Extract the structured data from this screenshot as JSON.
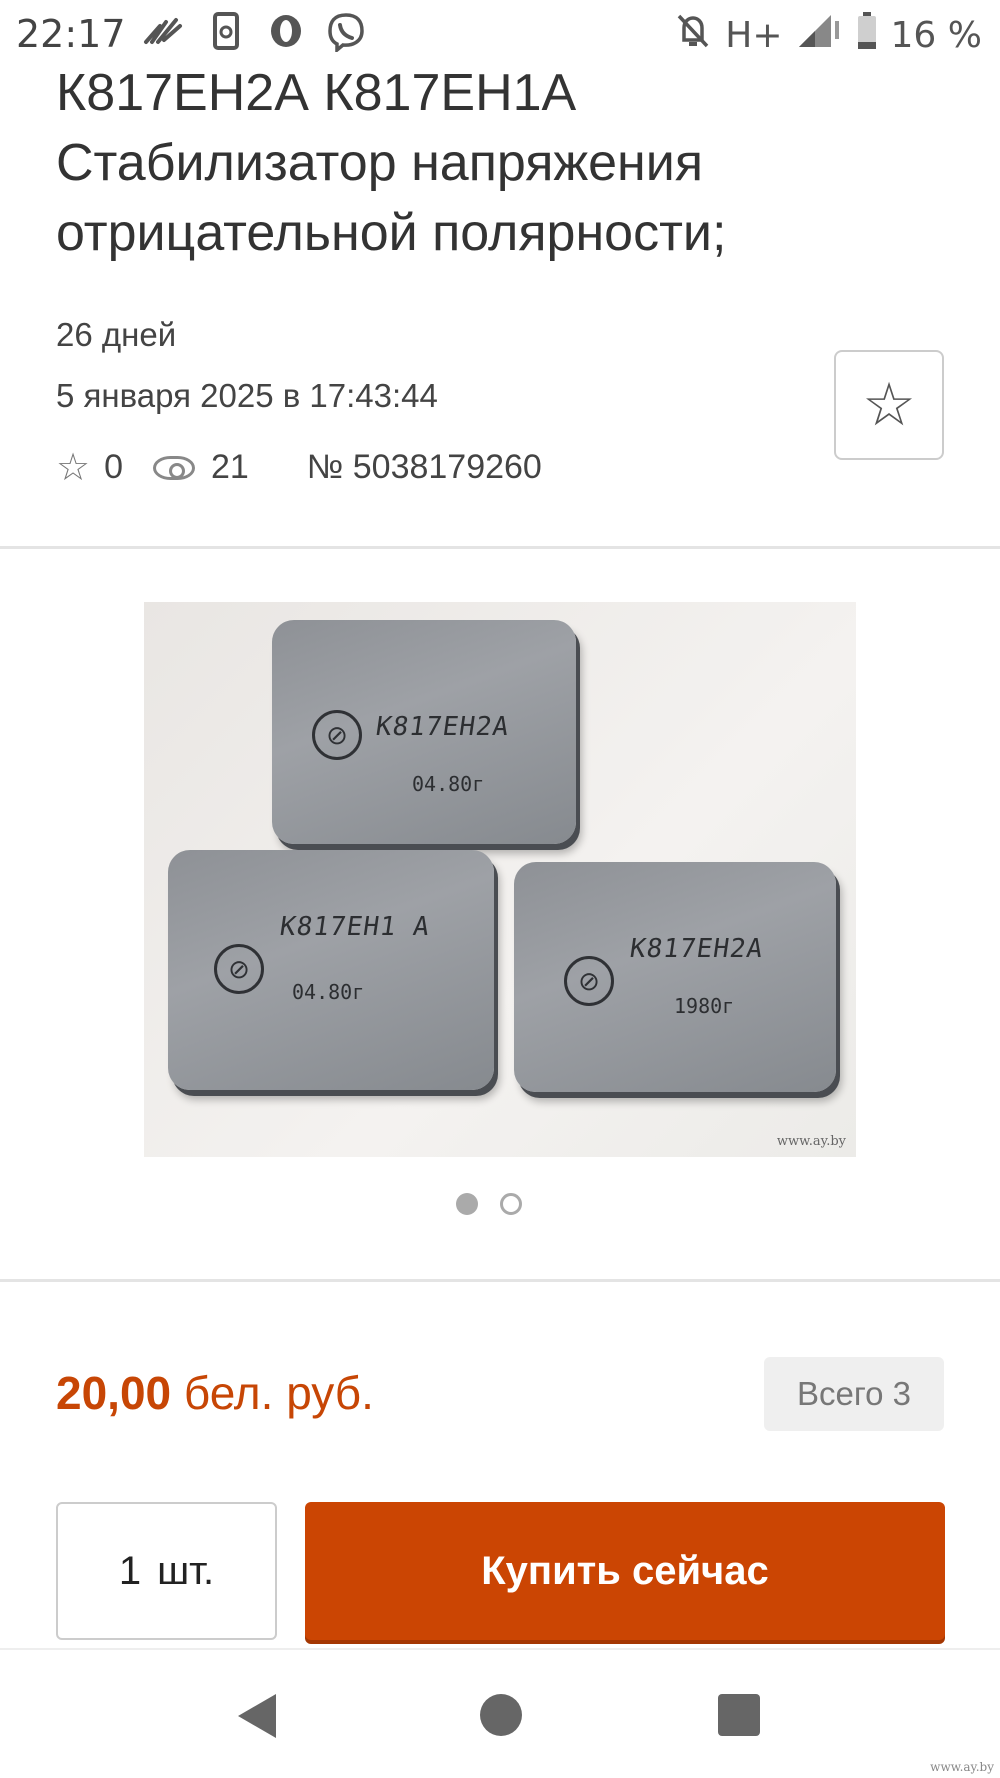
{
  "status_bar": {
    "time": "22:17",
    "network": "H+",
    "battery": "16 %",
    "icons": [
      "app-fan-icon",
      "sim-card-icon",
      "opera-icon",
      "viber-icon",
      "mute-icon",
      "signal-icon",
      "battery-icon"
    ]
  },
  "listing": {
    "title_line1": "К817ЕН2А К817ЕН1А",
    "title_line2": "Стабилизатор напряжения",
    "title_line3": "отрицательной полярности;",
    "days_left": "26 дней",
    "end_date": "5 января 2025 в 17:43:44",
    "favorites_count": "0",
    "views_count": "21",
    "lot_number": "№ 5038179260"
  },
  "photo": {
    "chip_labels": [
      "К817ЕН2А",
      "К817ЕН1 А",
      "К817ЕН2А"
    ],
    "chip_years": [
      "04.80г",
      "04.80г",
      "1980г"
    ],
    "watermark": "www.ay.by",
    "dots_total": 2,
    "dots_active": 1
  },
  "purchase": {
    "price_amount": "20,00",
    "price_currency": "бел. руб.",
    "stock_label": "Всего 3",
    "quantity_value": "1",
    "quantity_unit": "шт.",
    "buy_label": "Купить сейчас"
  },
  "footer": {
    "watermark": "www.ay.by"
  },
  "colors": {
    "accent": "#cb4503",
    "price": "#c74605"
  }
}
